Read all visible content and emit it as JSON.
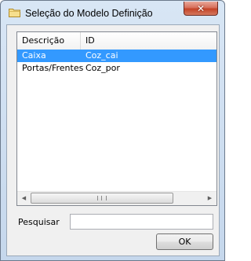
{
  "window": {
    "title": "Seleção do Modelo Definição",
    "icon": "folder-icon",
    "close_symbol": "✕"
  },
  "list": {
    "columns": [
      "Descrição",
      "ID"
    ],
    "rows": [
      {
        "descricao": "Caixa",
        "id": "Coz_cai",
        "selected": true
      },
      {
        "descricao": "Portas/Frentes",
        "id": "Coz_por",
        "selected": false
      }
    ],
    "scroll_left": "◀",
    "scroll_right": "▶"
  },
  "search": {
    "label": "Pesquisar",
    "value": ""
  },
  "buttons": {
    "ok_label": "OK"
  },
  "colors": {
    "selection": "#3399ff",
    "title_gradient": "#d8e6f5"
  }
}
